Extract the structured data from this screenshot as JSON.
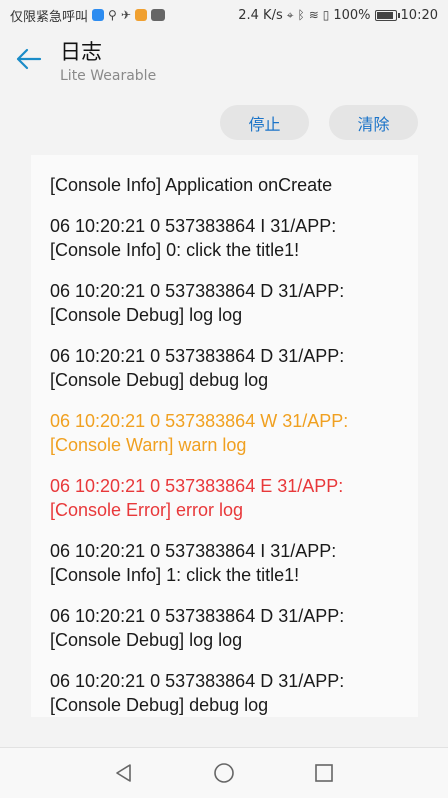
{
  "status_bar": {
    "carrier_text": "仅限紧急呼叫",
    "net_speed": "2.4 K/s",
    "battery_text": "100%",
    "time": "10:20",
    "battery_level": 1.0
  },
  "header": {
    "title": "日志",
    "subtitle": "Lite Wearable",
    "back_icon": "arrow-left-icon",
    "accent_color": "#1a8cc8"
  },
  "actions": {
    "stop_label": "停止",
    "clear_label": "清除"
  },
  "log": {
    "entries": [
      {
        "text": "[Console Info] Application onCreate",
        "level": "info"
      },
      {
        "text": "06 10:20:21 0 537383864 I 31/APP:\n[Console Info] 0: click the title1!",
        "level": "info"
      },
      {
        "text": "06 10:20:21 0 537383864 D 31/APP:\n[Console Debug] log log",
        "level": "debug"
      },
      {
        "text": "06 10:20:21 0 537383864 D 31/APP:\n[Console Debug] debug log",
        "level": "debug"
      },
      {
        "text": "06 10:20:21 0 537383864 W 31/APP:\n[Console Warn] warn log",
        "level": "warn"
      },
      {
        "text": "06 10:20:21 0 537383864 E 31/APP:\n[Console Error] error log",
        "level": "error"
      },
      {
        "text": "06 10:20:21 0 537383864 I 31/APP:\n[Console Info] 1: click the title1!",
        "level": "info"
      },
      {
        "text": "06 10:20:21 0 537383864 D 31/APP:\n[Console Debug] log log",
        "level": "debug"
      },
      {
        "text": "06 10:20:21 0 537383864 D 31/APP:\n[Console Debug] debug log",
        "level": "debug"
      }
    ],
    "colors": {
      "warn": "#f0a020",
      "error": "#e8383a",
      "default": "#1a1a1a"
    }
  },
  "nav_bar": {
    "back_icon": "triangle-back-icon",
    "home_icon": "circle-home-icon",
    "recent_icon": "square-recent-icon"
  }
}
